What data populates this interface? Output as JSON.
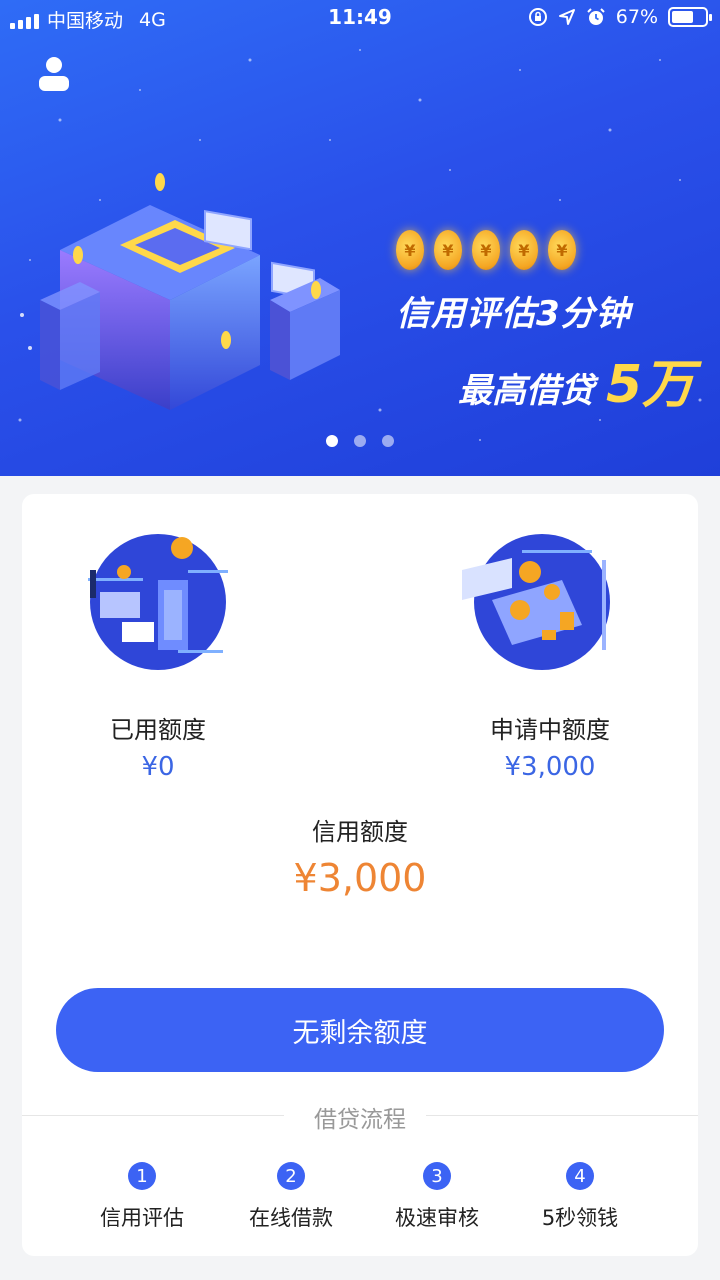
{
  "status_bar": {
    "carrier": "中国移动",
    "network": "4G",
    "time": "11:49",
    "battery": "67%",
    "battery_level": 0.67
  },
  "banner": {
    "slogan_line1": "信用评估3分钟",
    "slogan_line2": "最高借贷",
    "slogan_highlight": "5万",
    "coin_symbol": "¥",
    "coin_count": 5,
    "carousel_active_index": 0,
    "carousel_count": 3
  },
  "quota": {
    "used_label": "已用额度",
    "used_value": "¥0",
    "applying_label": "申请中额度",
    "applying_value": "¥3,000",
    "credit_label": "信用额度",
    "credit_value": "¥3,000"
  },
  "action": {
    "button_label": "无剩余额度"
  },
  "process": {
    "title": "借贷流程",
    "steps": [
      {
        "num": "1",
        "label": "信用评估"
      },
      {
        "num": "2",
        "label": "在线借款"
      },
      {
        "num": "3",
        "label": "极速审核"
      },
      {
        "num": "4",
        "label": "5秒领钱"
      }
    ]
  },
  "colors": {
    "accent": "#3c63f4",
    "value_blue": "#3b66e4",
    "credit_orange": "#ee8534",
    "highlight_yellow": "#ffd84a"
  },
  "icons": {
    "user": "user-icon",
    "signal": "signal-icon",
    "lock_rotation": "lock-rotation-icon",
    "location": "location-arrow-icon",
    "alarm": "alarm-icon",
    "battery": "battery-icon"
  }
}
